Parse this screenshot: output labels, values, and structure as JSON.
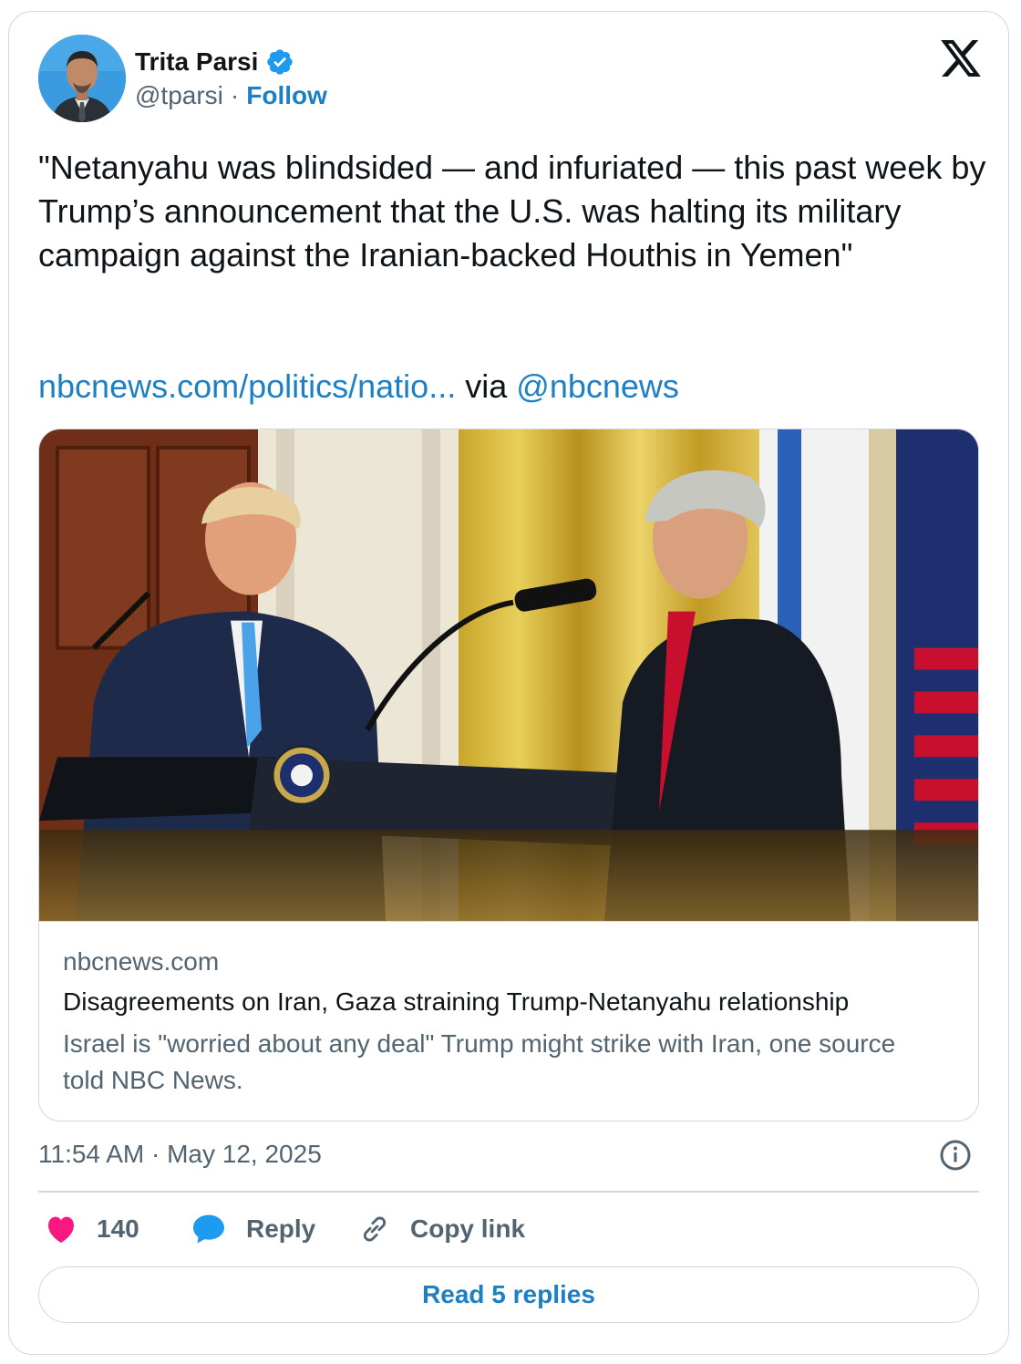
{
  "author": {
    "name": "Trita Parsi",
    "handle": "@tparsi",
    "separator": "·",
    "follow_label": "Follow"
  },
  "icons": {
    "verified": "verified-badge-icon",
    "platform": "x-logo-icon",
    "info": "info-icon",
    "like": "heart-icon",
    "reply": "reply-bubble-icon",
    "copy": "link-icon"
  },
  "tweet": {
    "text": "\"Netanyahu was blindsided — and infuriated — this past week by Trump’s announcement that the U.S. was halting its military campaign against the Iranian-backed Houthis in Yemen\"",
    "link_text": "nbcnews.com/politics/natio...",
    "via_text": "via",
    "mention": "@nbcnews"
  },
  "link_card": {
    "domain": "nbcnews.com",
    "title": "Disagreements on Iran, Gaza straining Trump-Netanyahu relationship",
    "description": "Israel is \"worried about any deal\" Trump might strike with Iran, one source told NBC News."
  },
  "meta": {
    "timestamp": "11:54 AM · May 12, 2025"
  },
  "actions": {
    "like_count": "140",
    "reply_label": "Reply",
    "copy_label": "Copy link",
    "read_replies_label": "Read 5 replies"
  },
  "colors": {
    "link_blue": "#1d7fc4",
    "like_pink": "#f91880",
    "reply_blue": "#1d9bf0",
    "muted": "#536471",
    "border": "#cfd9de"
  }
}
